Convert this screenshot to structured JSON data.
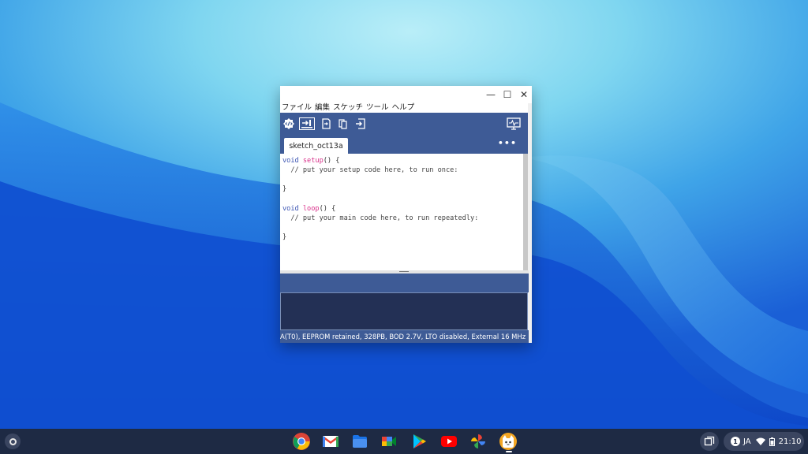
{
  "window": {
    "controls": {
      "minimize": "—",
      "maximize": "☐",
      "close": "✕"
    },
    "menu": [
      "ファイル",
      "編集",
      "スケッチ",
      "ツール",
      "ヘルプ"
    ],
    "toolbar": {
      "buttons": [
        "verify-icon",
        "upload-icon",
        "new-icon",
        "open-icon",
        "save-icon"
      ],
      "serial_monitor": "serial-monitor-icon"
    },
    "tab": {
      "label": "sketch_oct13a",
      "more": "•••"
    },
    "code": {
      "l1_kw": "void ",
      "l1_fn": "setup",
      "l1_rest": "() {",
      "l2": "  // put your setup code here, to run once:",
      "l4": "}",
      "l6_kw": "void ",
      "l6_fn": "loop",
      "l6_rest": "() {",
      "l7": "  // put your main code here, to run repeatedly:",
      "l9": "}"
    },
    "status": "A(T0), EEPROM retained, 328PB, BOD 2.7V, LTO disabled, External 16 MHz"
  },
  "shelf": {
    "apps": [
      "chrome-icon",
      "gmail-icon",
      "files-icon",
      "meet-icon",
      "play-store-icon",
      "youtube-icon",
      "photos-icon",
      "arduino-icon"
    ],
    "tray": {
      "notifications": "1",
      "ime": "JA",
      "time": "21:10"
    }
  },
  "colors": {
    "arduino_blue": "#3e5b96",
    "keyword": "#3b54b3",
    "function": "#d9308a",
    "shelf": "#1e2a44"
  }
}
